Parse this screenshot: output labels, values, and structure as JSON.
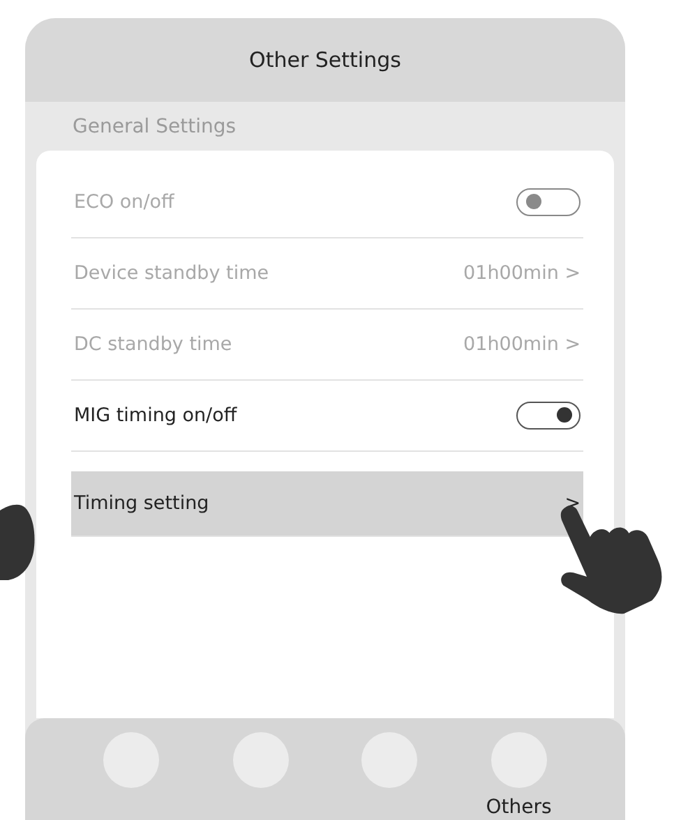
{
  "header": {
    "title": "Other Settings"
  },
  "section": {
    "label": "General Settings"
  },
  "rows": [
    {
      "kind": "toggle",
      "label": "ECO on/off",
      "on": false,
      "disabled": true,
      "selected": false
    },
    {
      "kind": "value",
      "label": "Device standby time",
      "value": "01h00min",
      "chevron": ">",
      "disabled": true,
      "selected": false
    },
    {
      "kind": "value",
      "label": "DC standby time",
      "value": "01h00min",
      "chevron": ">",
      "disabled": true,
      "selected": false
    },
    {
      "kind": "toggle",
      "label": "MIG timing on/off",
      "on": true,
      "disabled": false,
      "selected": false
    },
    {
      "kind": "value",
      "label": "Timing setting",
      "chevron": ">",
      "disabled": false,
      "selected": true
    }
  ],
  "nav_items": [
    {
      "kind": "icon"
    },
    {
      "kind": "icon"
    },
    {
      "kind": "icon"
    },
    {
      "kind": "labeled",
      "label": "Others"
    }
  ]
}
